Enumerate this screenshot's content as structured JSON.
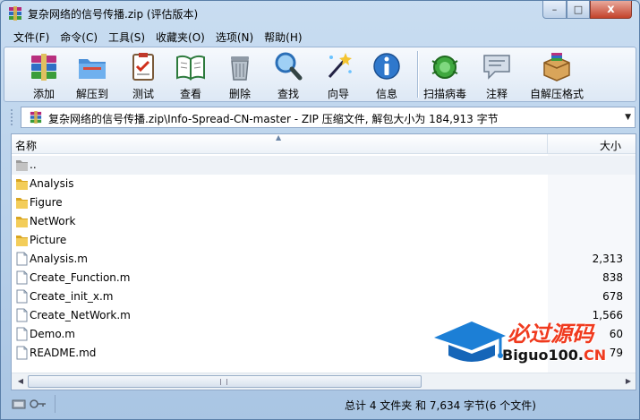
{
  "window": {
    "title": "复杂网络的信号传播.zip (评估版本)",
    "controls": {
      "minimize": "–",
      "maximize": "□",
      "close": "x"
    }
  },
  "menu": [
    "文件(F)",
    "命令(C)",
    "工具(S)",
    "收藏夹(O)",
    "选项(N)",
    "帮助(H)"
  ],
  "toolbar": [
    {
      "label": "添加",
      "icon": "add-books-icon"
    },
    {
      "label": "解压到",
      "icon": "extract-folder-icon"
    },
    {
      "label": "测试",
      "icon": "test-clipboard-icon"
    },
    {
      "label": "查看",
      "icon": "view-book-icon"
    },
    {
      "label": "删除",
      "icon": "trash-icon"
    },
    {
      "label": "查找",
      "icon": "magnifier-icon"
    },
    {
      "label": "向导",
      "icon": "wand-icon"
    },
    {
      "label": "信息",
      "icon": "info-icon"
    },
    {
      "label": "扫描病毒",
      "icon": "bug-icon"
    },
    {
      "label": "注释",
      "icon": "comment-icon"
    },
    {
      "label": "自解压格式",
      "icon": "sfx-box-icon"
    }
  ],
  "address": {
    "path": "复杂网络的信号传播.zip\\Info-Spread-CN-master - ZIP 压缩文件, 解包大小为 184,913 字节"
  },
  "columns": {
    "name": "名称",
    "size": "大小"
  },
  "files": [
    {
      "name": "..",
      "size": "",
      "type": "parent"
    },
    {
      "name": "Analysis",
      "size": "",
      "type": "folder"
    },
    {
      "name": "Figure",
      "size": "",
      "type": "folder"
    },
    {
      "name": "NetWork",
      "size": "",
      "type": "folder"
    },
    {
      "name": "Picture",
      "size": "",
      "type": "folder"
    },
    {
      "name": "Analysis.m",
      "size": "2,313",
      "type": "file"
    },
    {
      "name": "Create_Function.m",
      "size": "838",
      "type": "file"
    },
    {
      "name": "Create_init_x.m",
      "size": "678",
      "type": "file"
    },
    {
      "name": "Create_NetWork.m",
      "size": "1,566",
      "type": "file"
    },
    {
      "name": "Demo.m",
      "size": "60",
      "type": "file"
    },
    {
      "name": "README.md",
      "size": "79",
      "type": "file"
    }
  ],
  "status": {
    "text": "总计 4 文件夹 和 7,634 字节(6 个文件)"
  },
  "watermark": {
    "line1": "必过源码",
    "line2_main": "Biguo100.",
    "line2_suffix": "CN"
  }
}
